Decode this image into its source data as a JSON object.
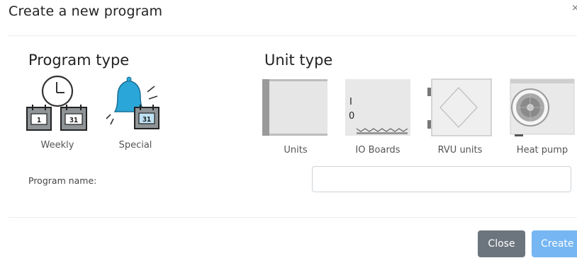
{
  "modal": {
    "title": "Create a new program",
    "close_icon": "×"
  },
  "program_type": {
    "title": "Program type",
    "options": [
      {
        "label": "Weekly",
        "icon": "weekly-calendar-clock-icon",
        "calendar_left_day": "1",
        "calendar_right_day": "31"
      },
      {
        "label": "Special",
        "icon": "special-bell-calendar-icon",
        "calendar_day": "31"
      }
    ]
  },
  "unit_type": {
    "title": "Unit type",
    "options": [
      {
        "label": "Units",
        "icon": "unit-cabinet-icon"
      },
      {
        "label": "IO Boards",
        "icon": "io-board-icon",
        "mark_top": "I",
        "mark_bottom": "0"
      },
      {
        "label": "RVU units",
        "icon": "rvu-unit-icon"
      },
      {
        "label": "Heat pump",
        "icon": "heat-pump-icon"
      }
    ]
  },
  "form": {
    "program_name_label": "Program name:",
    "program_name_value": "",
    "program_name_placeholder": ""
  },
  "footer": {
    "close_label": "Close",
    "create_label": "Create"
  },
  "colors": {
    "close_button": "#6c757d",
    "create_button": "#75b6f3",
    "bell_blue": "#2aa7d8",
    "calendar_fill": "#8f9497"
  }
}
